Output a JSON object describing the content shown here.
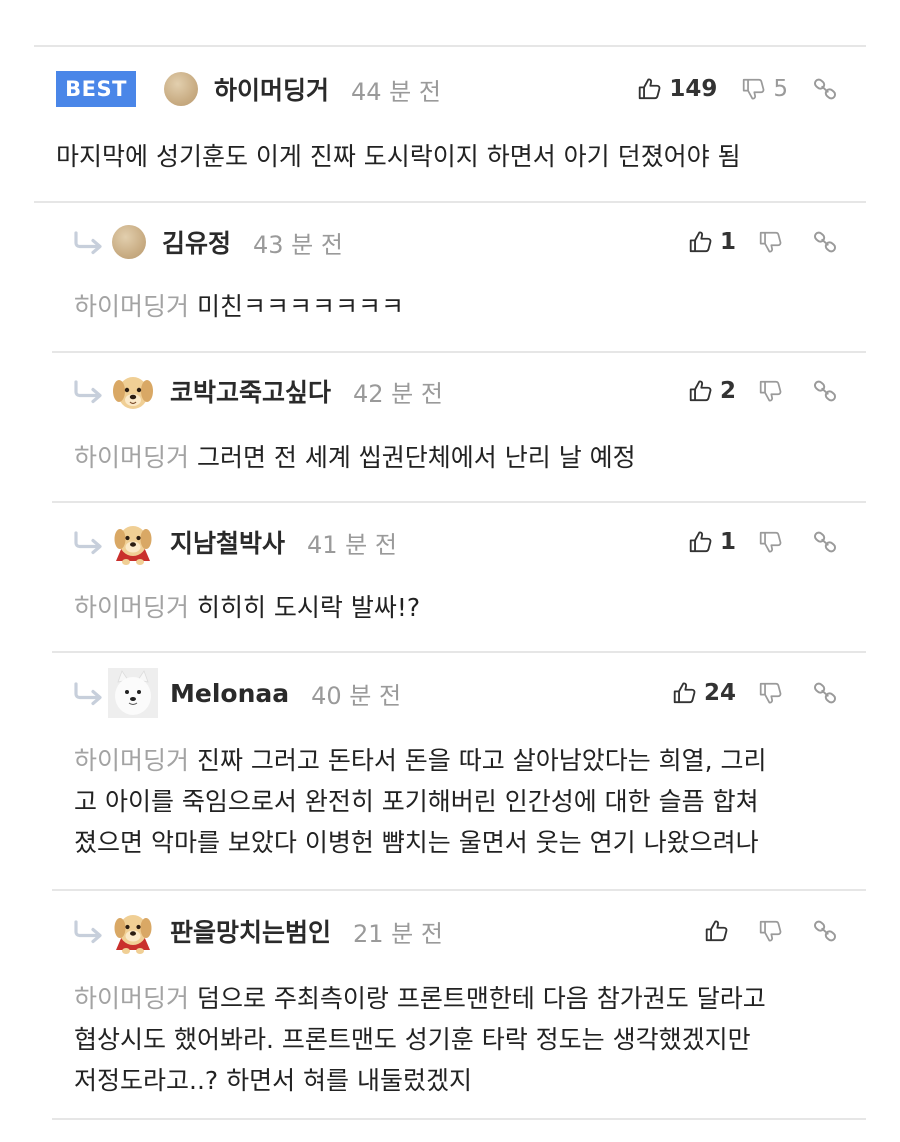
{
  "best_comment": {
    "badge": "BEST",
    "username": "하이머딩거",
    "time": "44 분 전",
    "likes": "149",
    "dislikes": "5",
    "text": "마지막에 성기훈도 이게 진짜 도시락이지 하면서 아기 던졌어야 됨"
  },
  "replies": [
    {
      "username": "김유정",
      "time": "43 분 전",
      "likes": "1",
      "mention": "하이머딩거",
      "text": "미친ㅋㅋㅋㅋㅋㅋㅋ",
      "avatar": "beige-circle"
    },
    {
      "username": "코박고죽고싶다",
      "time": "42 분 전",
      "likes": "2",
      "mention": "하이머딩거",
      "text": "그러면 전 세계 씹권단체에서 난리 날 예정",
      "avatar": "golden-puppy"
    },
    {
      "username": "지남철박사",
      "time": "41 분 전",
      "likes": "1",
      "mention": "하이머딩거",
      "text": "히히히 도시락 발싸!?",
      "avatar": "golden-puppy-red-cape"
    },
    {
      "username": "Melonaa",
      "time": "40 분 전",
      "likes": "24",
      "mention": "하이머딩거",
      "text": "진짜 그러고 돈타서 돈을 따고 살아남았다는 희열, 그리고 아이를 죽임으로서 완전히 포기해버린 인간성에 대한 슬픔 합쳐졌으면 악마를 보았다 이병헌 뺨치는 울면서 웃는 연기 나왔으려나",
      "lines": [
        "진짜 그러고 돈타서 돈을 따고 살아남았다는 희열, 그리",
        "고 아이를 죽임으로서 완전히 포기해버린 인간성에 대한 슬픔 합쳐",
        "졌으면 악마를 보았다 이병헌 뺨치는 울면서 웃는 연기 나왔으려나"
      ],
      "avatar": "white-samoyed"
    },
    {
      "username": "판을망치는범인",
      "time": "21 분 전",
      "likes": "",
      "mention": "하이머딩거",
      "lines": [
        "덤으로 주최측이랑 프론트맨한테 다음 참가권도 달라고",
        "협상시도 했어봐라. 프론트맨도 성기훈 타락 정도는 생각했겠지만",
        "저정도라고..? 하면서 혀를 내둘렀겠지"
      ],
      "avatar": "golden-puppy-red-cape"
    }
  ],
  "icons": {
    "like": "thumbs-up-icon",
    "dislike": "thumbs-down-icon",
    "share": "link-icon",
    "reply": "reply-arrow-icon"
  },
  "colors": {
    "best_badge": "#4a86e8",
    "mention": "#a3a3a3",
    "divider": "#e6e6e6"
  }
}
